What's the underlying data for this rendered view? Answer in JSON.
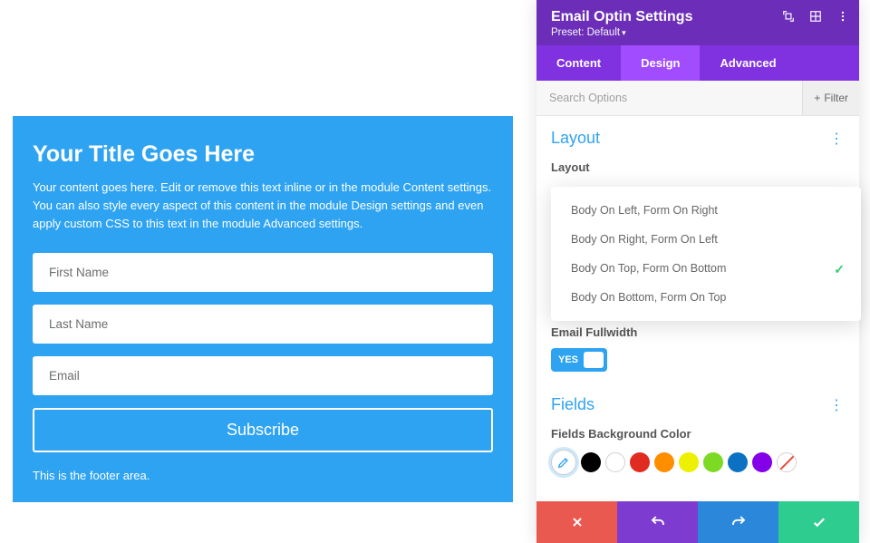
{
  "optin": {
    "title": "Your Title Goes Here",
    "body": "Your content goes here. Edit or remove this text inline or in the module Content settings. You can also style every aspect of this content in the module Design settings and even apply custom CSS to this text in the module Advanced settings.",
    "first_name_placeholder": "First Name",
    "last_name_placeholder": "Last Name",
    "email_placeholder": "Email",
    "subscribe_label": "Subscribe",
    "footer": "This is the footer area."
  },
  "panel": {
    "title": "Email Optin Settings",
    "preset_label": "Preset: Default",
    "tabs": {
      "content": "Content",
      "design": "Design",
      "advanced": "Advanced"
    },
    "search_placeholder": "Search Options",
    "filter_label": "Filter",
    "sections": {
      "layout": {
        "title": "Layout",
        "label": "Layout",
        "options": [
          "Body On Left, Form On Right",
          "Body On Right, Form On Left",
          "Body On Top, Form On Bottom",
          "Body On Bottom, Form On Top"
        ],
        "selected_index": 2,
        "email_fullwidth_label": "Email Fullwidth",
        "toggle_yes": "YES"
      },
      "fields": {
        "title": "Fields",
        "bg_label": "Fields Background Color",
        "colors": [
          "#000000",
          "#ffffff",
          "#e02b20",
          "#ff8d00",
          "#edf000",
          "#7cda24",
          "#0c71c3",
          "#8300e9",
          "none"
        ]
      }
    }
  }
}
